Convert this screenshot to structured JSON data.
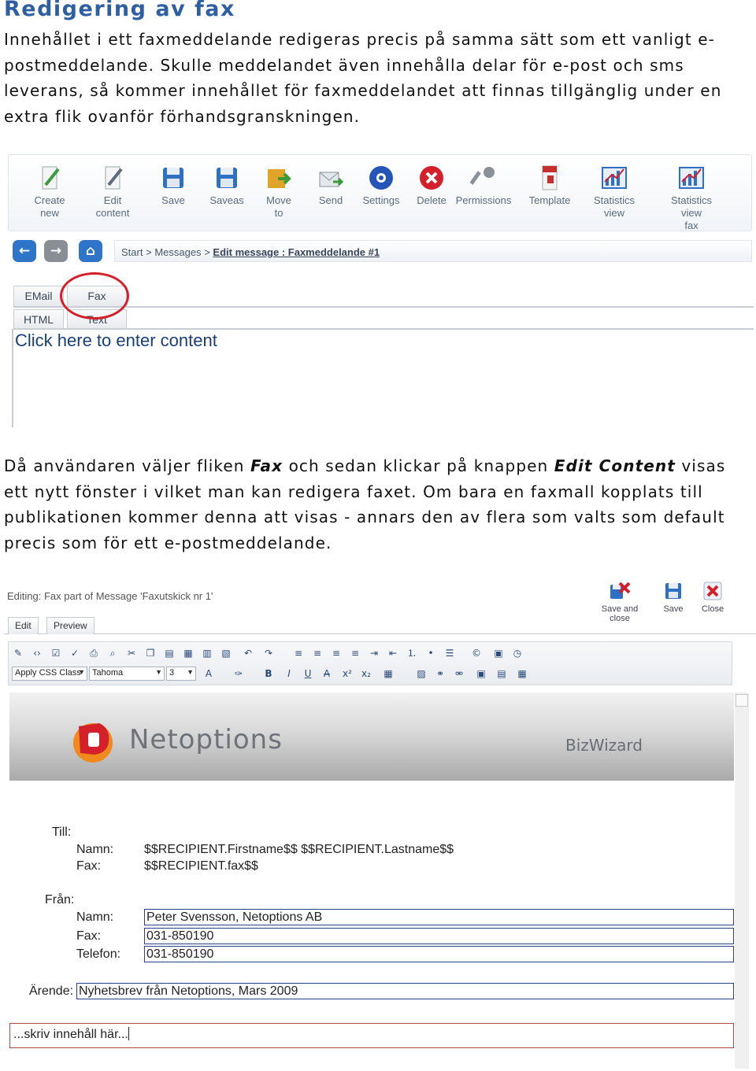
{
  "heading": "Redigering av fax",
  "paragraph1": "Innehållet i ett faxmeddelande redigeras precis på samma sätt som ett vanligt e-postmeddelande. Skulle meddelandet även innehålla delar för e-post och sms leverans, så kommer innehållet för faxmeddelandet att finnas tillgänglig under en extra flik ovanför förhandsgranskningen.",
  "paragraph2": {
    "part1": "Då användaren väljer fliken ",
    "fax_word": "Fax",
    "part2": " och sedan klickar på knappen ",
    "edit_content": "Edit Content",
    "part3": " visas ett nytt fönster i vilket man kan redigera faxet. Om bara en faxmall kopplats till publikationen kommer denna att visas - annars den av flera som valts som default precis som för ett e-postmeddelande."
  },
  "shot1": {
    "toolbar": [
      {
        "label1": "Create",
        "label2": "new",
        "icon": "create-new-icon"
      },
      {
        "label1": "Edit",
        "label2": "content",
        "icon": "edit-content-icon"
      },
      {
        "label1": "Save",
        "label2": "",
        "icon": "save-icon"
      },
      {
        "label1": "Saveas",
        "label2": "",
        "icon": "save-as-icon"
      },
      {
        "label1": "Move",
        "label2": "to",
        "icon": "move-to-icon"
      },
      {
        "label1": "Send",
        "label2": "",
        "icon": "send-icon"
      },
      {
        "label1": "Settings",
        "label2": "",
        "icon": "settings-icon"
      },
      {
        "label1": "Delete",
        "label2": "",
        "icon": "delete-icon"
      },
      {
        "label1": "Permissions",
        "label2": "",
        "icon": "permissions-icon"
      },
      {
        "label1": "Template",
        "label2": "",
        "icon": "template-icon"
      },
      {
        "label1": "Statistics",
        "label2": "view",
        "icon": "statistics-view-icon"
      },
      {
        "label1": "Statistics view",
        "label2": "fax",
        "icon": "statistics-view-fax-icon"
      }
    ],
    "breadcrumb": {
      "start": "Start",
      "sep": ">",
      "messages": "Messages",
      "current": "Edit message : Faxmeddelande #1"
    },
    "tabs_top": [
      "EMail",
      "Fax"
    ],
    "tabs_bottom": [
      "HTML",
      "Text"
    ],
    "click_here": "Click here to enter content"
  },
  "shot2": {
    "editing_title": "Editing: Fax part of Message 'Faxutskick nr 1'",
    "actions": [
      "Save and close",
      "Save",
      "Close"
    ],
    "tabs": [
      "Edit",
      "Preview"
    ],
    "css_class": "Apply CSS Class",
    "font": "Tahoma",
    "size": "3",
    "logo_text": "Netoptions",
    "bizwizard": "BizWizard",
    "till_label": "Till:",
    "namn_label": "Namn:",
    "fax_label": "Fax:",
    "fran_label": "Från:",
    "telefon_label": "Telefon:",
    "arende_label": "Ärende:",
    "recipient_name": "$$RECIPIENT.Firstname$$ $$RECIPIENT.Lastname$$",
    "recipient_fax": "$$RECIPIENT.fax$$",
    "sender_name": "Peter Svensson, Netoptions AB",
    "sender_fax": "031-850190",
    "sender_phone": "031-850190",
    "subject": "Nyhetsbrev från Netoptions, Mars 2009",
    "content_placeholder": "...skriv innehåll här..."
  },
  "colors": {
    "heading": "#2f5fa3",
    "highlight_circle": "#d3202a",
    "form_border": "#2d3e8a"
  }
}
